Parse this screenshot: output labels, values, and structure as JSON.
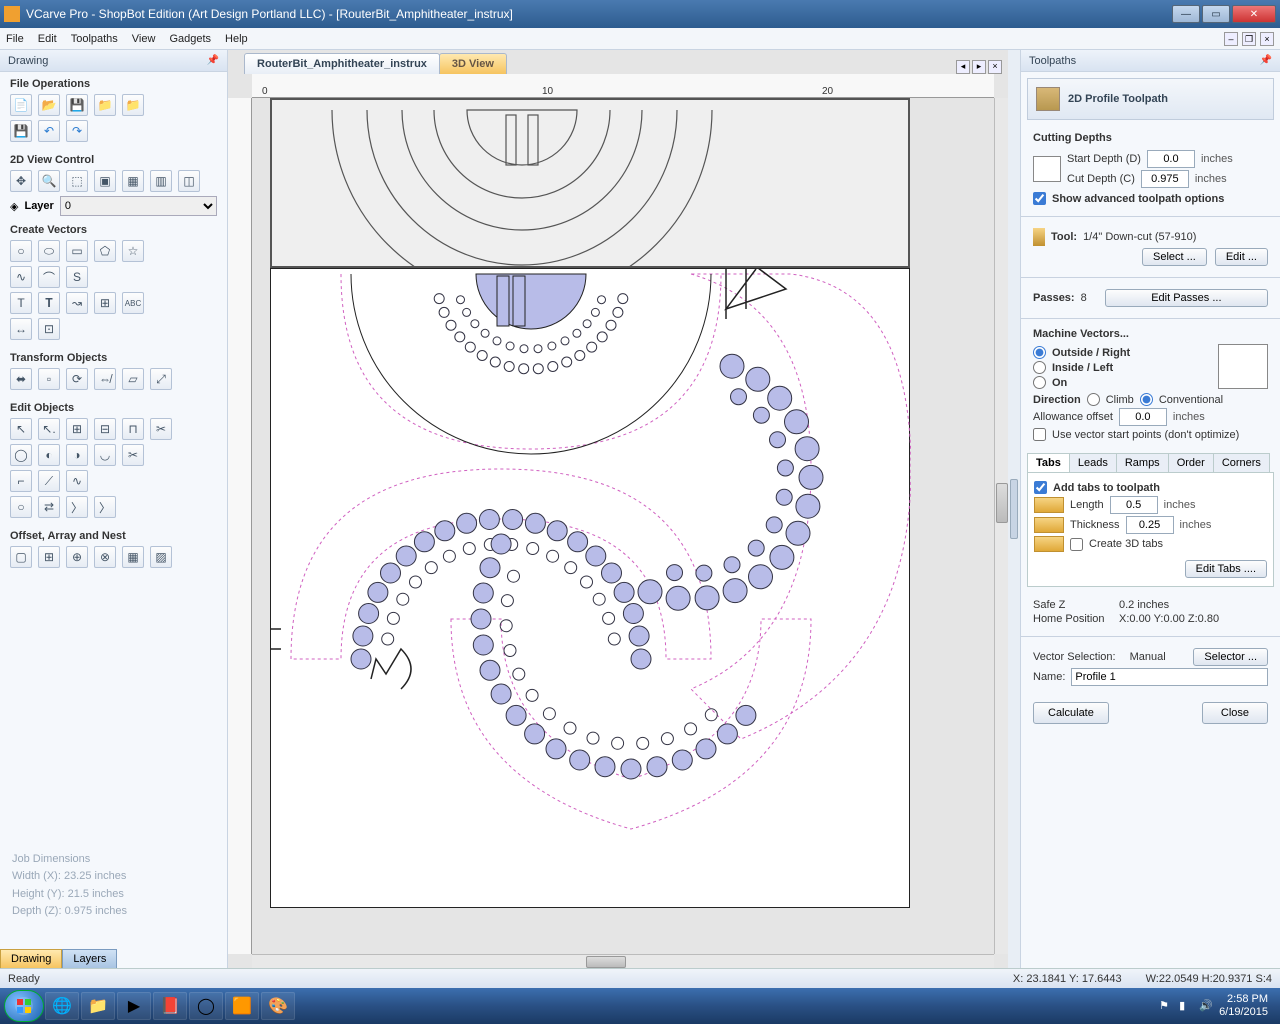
{
  "window": {
    "title": "VCarve Pro - ShopBot Edition (Art Design Portland LLC) - [RouterBit_Amphitheater_instrux]"
  },
  "menu": [
    "File",
    "Edit",
    "Toolpaths",
    "View",
    "Gadgets",
    "Help"
  ],
  "left": {
    "title": "Drawing",
    "fileops": "File Operations",
    "viewctrl": "2D View Control",
    "layer_label": "Layer",
    "layer_value": "0",
    "create": "Create Vectors",
    "transform": "Transform Objects",
    "edit": "Edit Objects",
    "offset": "Offset, Array and Nest",
    "jobdim": {
      "title": "Job Dimensions",
      "w": "Width  (X): 23.25 inches",
      "h": "Height (Y): 21.5 inches",
      "d": "Depth  (Z): 0.975 inches"
    },
    "tabs": [
      "Drawing",
      "Layers"
    ]
  },
  "doc_tabs": [
    "RouterBit_Amphitheater_instrux",
    "3D View"
  ],
  "ruler_ticks": [
    "0",
    "10",
    "20"
  ],
  "right": {
    "title": "Toolpaths",
    "header": "2D Profile Toolpath",
    "cutting_depths": "Cutting Depths",
    "start_depth_label": "Start Depth (D)",
    "start_depth": "0.0",
    "cut_depth_label": "Cut Depth (C)",
    "cut_depth": "0.975",
    "unit": "inches",
    "show_adv": "Show advanced toolpath options",
    "tool_label": "Tool:",
    "tool": "1/4\"  Down-cut (57-910)",
    "select": "Select ...",
    "edit": "Edit ...",
    "passes_label": "Passes:",
    "passes": "8",
    "edit_passes": "Edit Passes ...",
    "mv_title": "Machine Vectors...",
    "mv_outside": "Outside / Right",
    "mv_inside": "Inside / Left",
    "mv_on": "On",
    "direction": "Direction",
    "climb": "Climb",
    "conventional": "Conventional",
    "allowance_label": "Allowance offset",
    "allowance": "0.0",
    "use_start": "Use vector start points (don't optimize)",
    "subtabs": [
      "Tabs",
      "Leads",
      "Ramps",
      "Order",
      "Corners"
    ],
    "add_tabs": "Add tabs to toolpath",
    "length_label": "Length",
    "length": "0.5",
    "thick_label": "Thickness",
    "thick": "0.25",
    "create3d": "Create 3D tabs",
    "edit_tabs": "Edit Tabs ....",
    "safez_label": "Safe Z",
    "safez": "0.2 inches",
    "home_label": "Home Position",
    "home": "X:0.00 Y:0.00 Z:0.80",
    "vsel_label": "Vector Selection:",
    "vsel": "Manual",
    "selector": "Selector ...",
    "name_label": "Name:",
    "name": "Profile 1",
    "calculate": "Calculate",
    "close": "Close"
  },
  "status": {
    "ready": "Ready",
    "xy": "X: 23.1841 Y: 17.6443",
    "whs": "W:22.0549   H:20.9371   S:4"
  },
  "tray": {
    "time": "2:58 PM",
    "date": "6/19/2015"
  }
}
